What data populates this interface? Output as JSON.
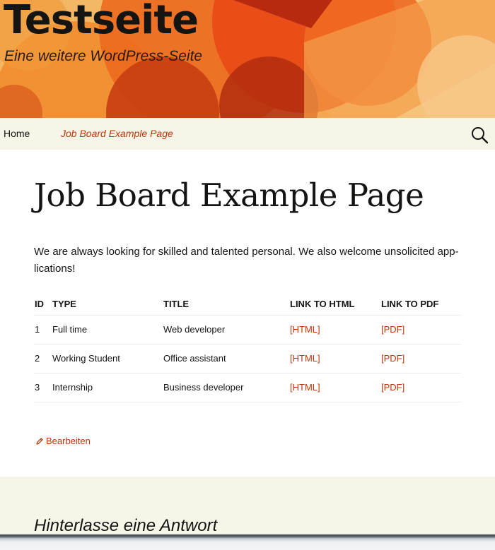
{
  "site": {
    "title": "Testseite",
    "description": "Eine weitere WordPress-Seite"
  },
  "nav": {
    "items": [
      {
        "label": "Home",
        "current": false
      },
      {
        "label": "Job Board Example Page",
        "current": true
      }
    ],
    "search_icon": "search-icon"
  },
  "page": {
    "title": "Job Board Example Page",
    "intro": "We are always looking for skilled and talented personal. We also welcome unsolicited app­lications!",
    "table": {
      "headers": [
        "ID",
        "TYPE",
        "TITLE",
        "LINK TO HTML",
        "LINK TO PDF"
      ],
      "rows": [
        {
          "id": "1",
          "type": "Full time",
          "title": "Web developer",
          "html": "[HTML]",
          "pdf": "[PDF]"
        },
        {
          "id": "2",
          "type": "Working Student",
          "title": "Office assistant",
          "html": "[HTML]",
          "pdf": "[PDF]"
        },
        {
          "id": "3",
          "type": "Internship",
          "title": "Business developer",
          "html": "[HTML]",
          "pdf": "[PDF]"
        }
      ]
    },
    "edit_label": "Bearbeiten"
  },
  "comments": {
    "reply_title": "Hinterlasse eine Antwort"
  },
  "colors": {
    "link": "#bc360a",
    "nav_bg": "#f7f5e7",
    "text": "#141412",
    "header_bg": "#f2b25c"
  }
}
